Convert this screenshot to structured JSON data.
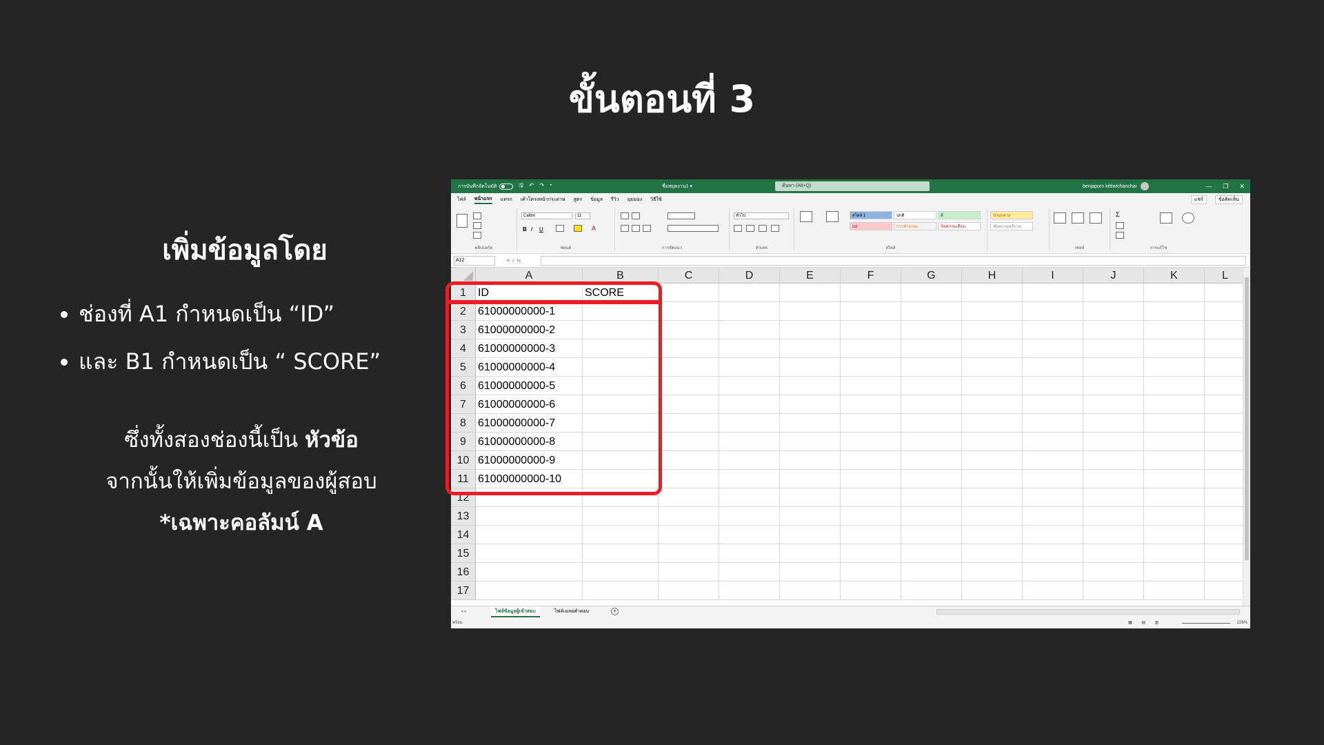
{
  "slide": {
    "title": "ขั้นตอนที่ 3",
    "subtitle": "เพิ่มข้อมูลโดย",
    "bullets": [
      "ช่องที่ A1 กำหนดเป็น “ID”",
      "และ B1 กำหนดเป็น “ SCORE”"
    ],
    "note_line1_pre": "ซึ่งทั้งสองช่องนี้เป็น ",
    "note_line1_bold": "หัวข้อ",
    "note_line2": "จากนั้นให้เพิ่มข้อมูลของผู้สอบ",
    "note_line3": "*เฉพาะคอลัมน์ A"
  },
  "excel": {
    "titlebar": {
      "autosave": "การบันทึกอัตโนมัติ",
      "doc": "ชื่อสมุดงาน1 ▾",
      "search": "ค้นหา (Alt+Q)",
      "user": "benjaporn kittiwichanchai",
      "controls": [
        "—",
        "❐",
        "✕"
      ]
    },
    "tabs": [
      "ไฟล์",
      "หน้าแรก",
      "แทรก",
      "เค้าโครงหน้ากระดาษ",
      "สูตร",
      "ข้อมูล",
      "รีวิว",
      "มุมมอง",
      "วิธีใช้"
    ],
    "share": "แชร์",
    "comments": "ข้อคิดเห็น",
    "ribbon": {
      "font": "Calibri",
      "size": "11",
      "number_format": "ทั่วไป",
      "groups": [
        "คลิปบอร์ด",
        "ฟอนต์",
        "การจัดแนว",
        "ตัวเลข",
        "สไตล์",
        "เซลล์",
        "การแก้ไข"
      ],
      "styles": [
        "สไตล์ 1",
        "ปกติ",
        "ดี",
        "ปานกลาง",
        "แย่",
        "การคำนวณ",
        "ข้อความเตือน",
        "ข้อความอธิบาย"
      ]
    },
    "name_box": "A12",
    "columns": [
      "A",
      "B",
      "C",
      "D",
      "E",
      "F",
      "G",
      "H",
      "I",
      "J",
      "K",
      "L"
    ],
    "rows": [
      {
        "num": "1",
        "a": "ID",
        "b": "SCORE"
      },
      {
        "num": "2",
        "a": "61000000000-1",
        "b": ""
      },
      {
        "num": "3",
        "a": "61000000000-2",
        "b": ""
      },
      {
        "num": "4",
        "a": "61000000000-3",
        "b": ""
      },
      {
        "num": "5",
        "a": "61000000000-4",
        "b": ""
      },
      {
        "num": "6",
        "a": "61000000000-5",
        "b": ""
      },
      {
        "num": "7",
        "a": "61000000000-6",
        "b": ""
      },
      {
        "num": "8",
        "a": "61000000000-7",
        "b": ""
      },
      {
        "num": "9",
        "a": "61000000000-8",
        "b": ""
      },
      {
        "num": "10",
        "a": "61000000000-9",
        "b": ""
      },
      {
        "num": "11",
        "a": "61000000000-10",
        "b": ""
      },
      {
        "num": "12",
        "a": "",
        "b": ""
      },
      {
        "num": "13",
        "a": "",
        "b": ""
      },
      {
        "num": "14",
        "a": "",
        "b": ""
      },
      {
        "num": "15",
        "a": "",
        "b": ""
      },
      {
        "num": "16",
        "a": "",
        "b": ""
      },
      {
        "num": "17",
        "a": "",
        "b": ""
      }
    ],
    "sheets": [
      "ไฟล์ข้อมูลผู้เข้าสอบ",
      "ไฟล์เฉลยคำตอบ"
    ],
    "status": "พร้อม",
    "zoom": "226%",
    "colors": {
      "green": "#217346",
      "highlight": "#ee1c25"
    }
  }
}
